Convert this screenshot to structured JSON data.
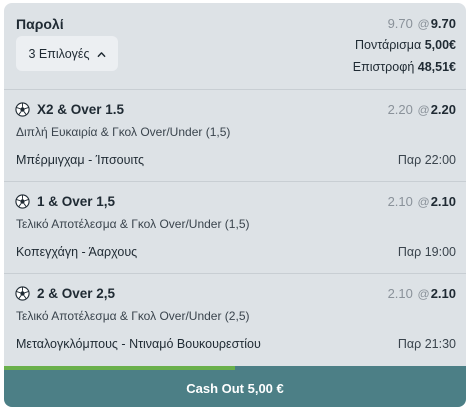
{
  "header": {
    "title": "Παρολί",
    "selections_label": "3 Επιλογές",
    "odds_old": "9.70",
    "odds_at": "@",
    "odds_new": "9.70",
    "stake_label": "Ποντάρισμα",
    "stake_value": "5,00€",
    "return_label": "Επιστροφή",
    "return_value": "48,51€"
  },
  "legs": [
    {
      "selection": "X2 & Over 1.5",
      "market": "Διπλή Ευκαιρία & Γκολ Over/Under (1,5)",
      "event": "Μπέρμιγχαμ - Ίπσουιτς",
      "time": "Παρ 22:00",
      "odds_old": "2.20",
      "odds_at": "@",
      "odds_new": "2.20"
    },
    {
      "selection": "1 & Over 1,5",
      "market": "Τελικό Αποτέλεσμα & Γκολ Over/Under (1,5)",
      "event": "Κοπεγχάγη - Άαρχους",
      "time": "Παρ 19:00",
      "odds_old": "2.10",
      "odds_at": "@",
      "odds_new": "2.10"
    },
    {
      "selection": "2 & Over 2,5",
      "market": "Τελικό Αποτέλεσμα & Γκολ Over/Under (2,5)",
      "event": "Μεταλογκλόμπους - Ντιναμό Βουκουρεστίου",
      "time": "Παρ 21:30",
      "odds_old": "2.10",
      "odds_at": "@",
      "odds_new": "2.10"
    }
  ],
  "cashout": {
    "label": "Cash Out 5,00 €",
    "progress_fraction": 0.5
  },
  "colors": {
    "card_bg": "#dde2e6",
    "button_bg": "#4c7f86",
    "progress": "#6ab04c"
  },
  "icons": {
    "sport": "soccer-ball-icon",
    "toggle": "chevron-up-icon"
  }
}
